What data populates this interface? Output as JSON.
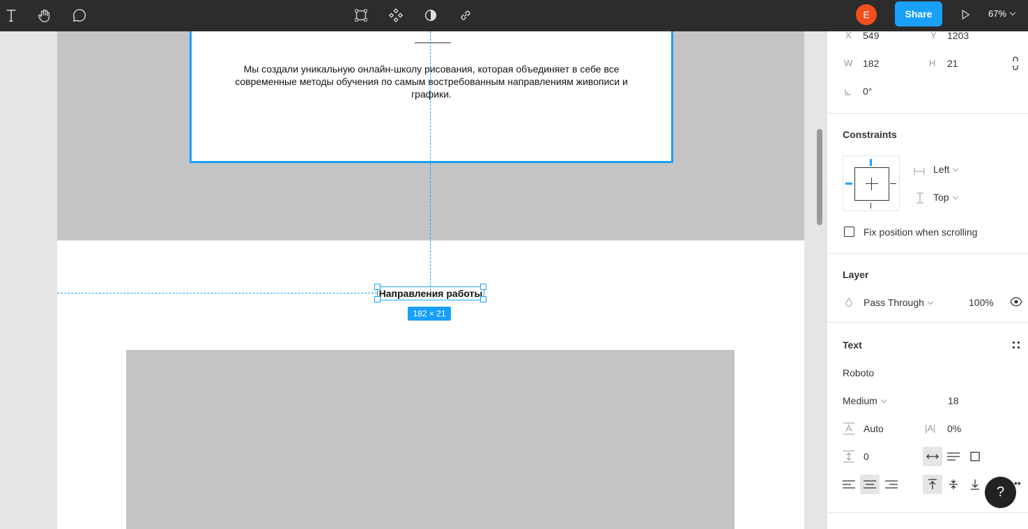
{
  "toolbar": {
    "avatar_letter": "E",
    "share_label": "Share",
    "zoom_label": "67%"
  },
  "canvas": {
    "card_text": "Мы создали уникальную онлайн-школу рисования, которая объединяет в себе все современные методы обучения по самым востребованным направлениям живописи и графики.",
    "selected_text": "Направления работы",
    "size_tag": "182 × 21"
  },
  "panel": {
    "x_label": "X",
    "x_value": "549",
    "y_label": "Y",
    "y_value": "1203",
    "w_label": "W",
    "w_value": "182",
    "h_label": "H",
    "h_value": "21",
    "rotation_value": "0°",
    "constraints_title": "Constraints",
    "constraint_h": "Left",
    "constraint_v": "Top",
    "fix_position_label": "Fix position when scrolling",
    "layer_title": "Layer",
    "blend_mode": "Pass Through",
    "opacity": "100%",
    "text_title": "Text",
    "font_family": "Roboto",
    "font_weight": "Medium",
    "font_size": "18",
    "line_height": "Auto",
    "letter_spacing": "0%",
    "paragraph_spacing": "0"
  },
  "help_label": "?"
}
